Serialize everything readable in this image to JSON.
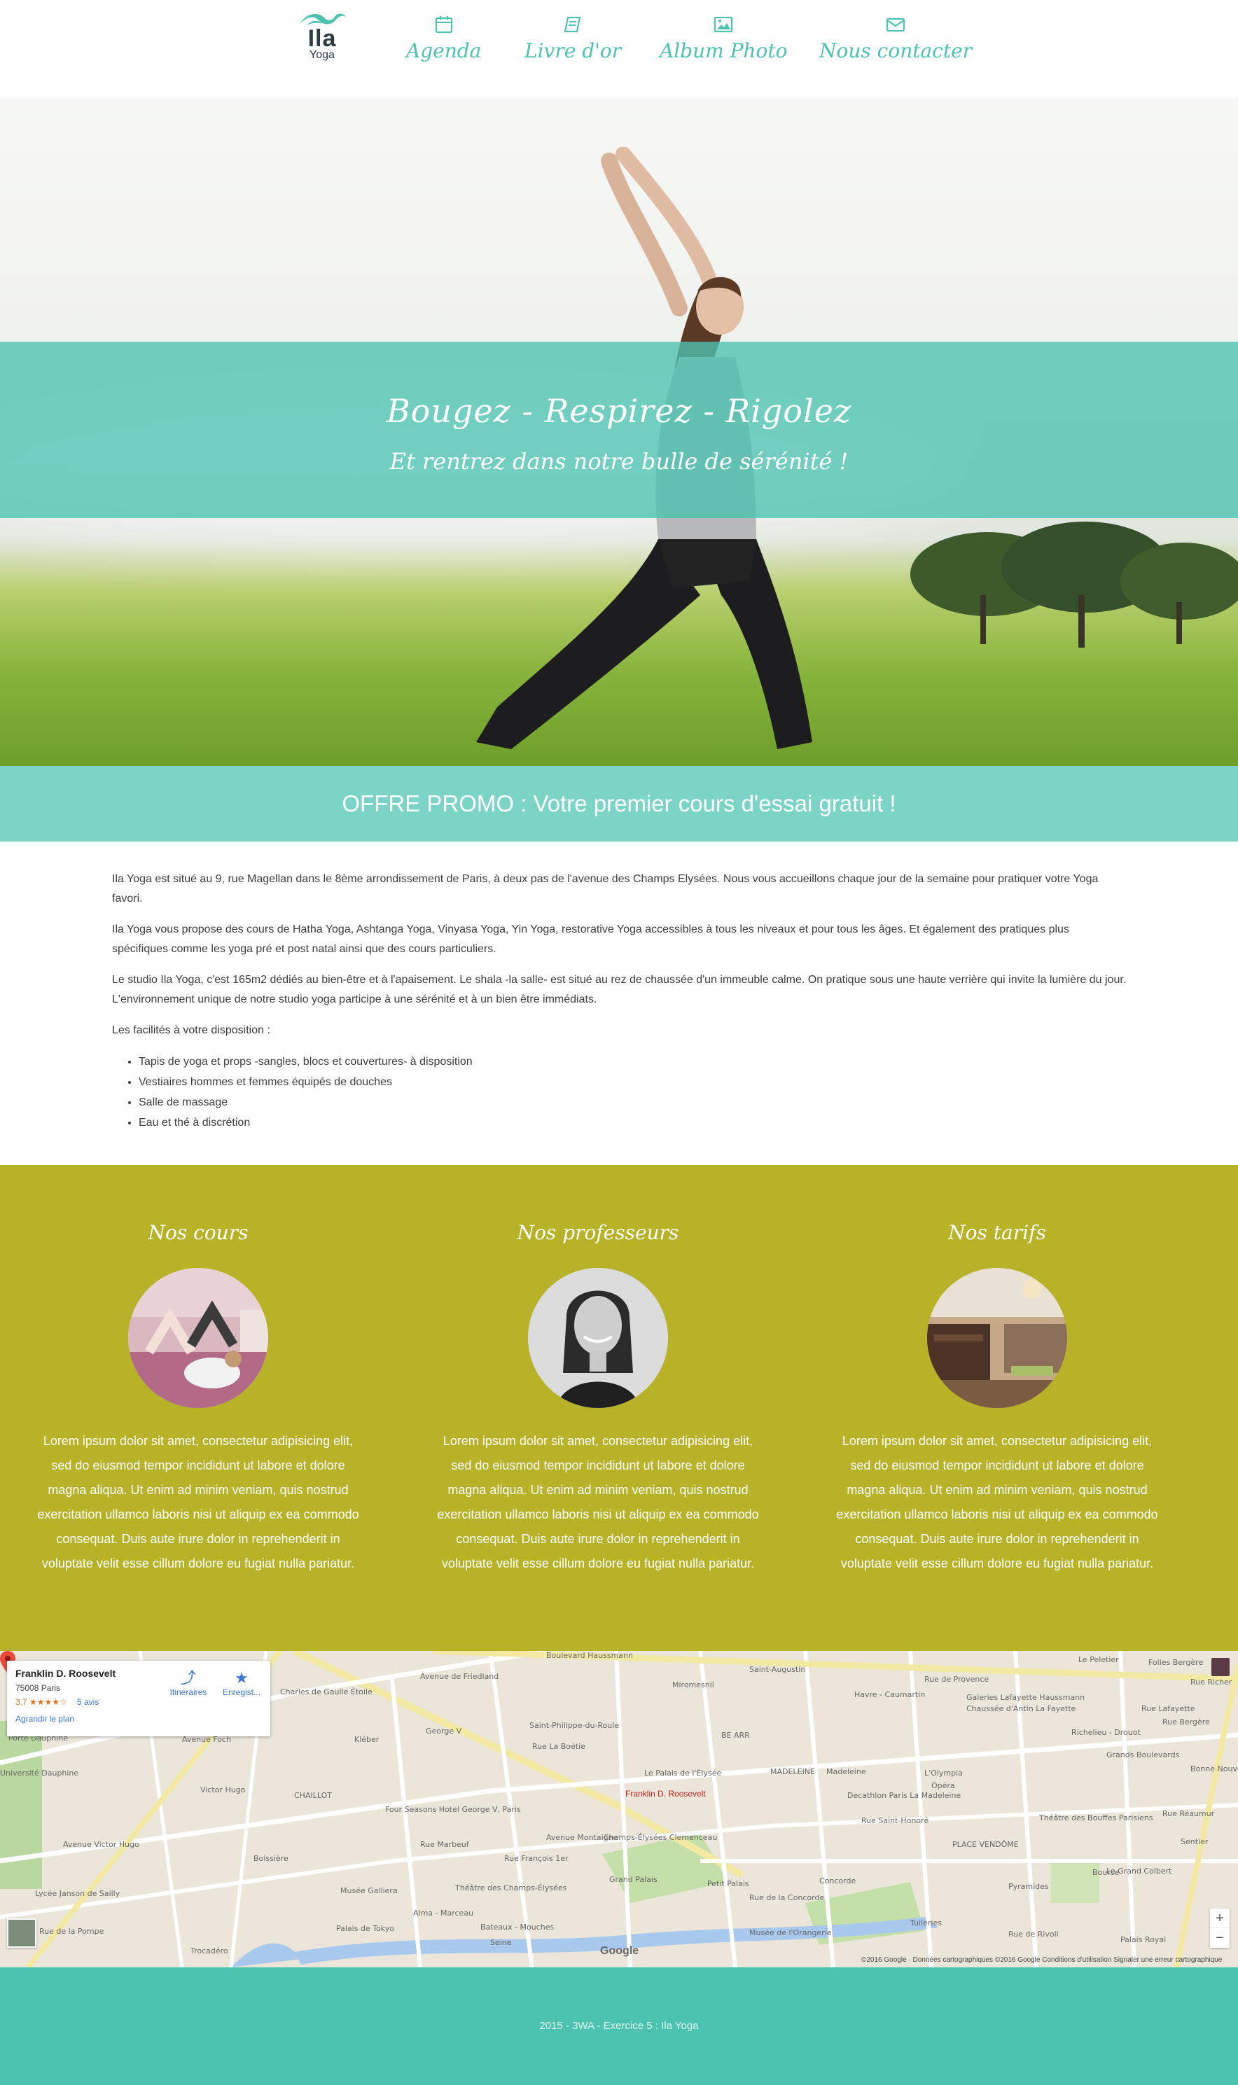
{
  "header": {
    "logo_name": "Ila",
    "logo_sub": "Yoga",
    "nav": [
      {
        "label": "Agenda",
        "icon": "calendar-icon"
      },
      {
        "label": "Livre d'or",
        "icon": "book-icon"
      },
      {
        "label": "Album Photo",
        "icon": "picture-icon"
      },
      {
        "label": "Nous contacter",
        "icon": "envelope-icon"
      }
    ]
  },
  "hero": {
    "title": "Bougez - Respirez - Rigolez",
    "subtitle": "Et rentrez dans notre bulle de sérénité !"
  },
  "promo": "OFFRE PROMO : Votre premier cours d'essai gratuit !",
  "intro": {
    "paragraphs": [
      "Ila Yoga est situé au 9, rue Magellan dans le 8ème arrondissement de Paris, à deux pas de l'avenue des Champs Elysées. Nous vous accueillons chaque jour de la semaine pour pratiquer votre Yoga favori.",
      "Ila Yoga vous propose des cours de Hatha Yoga, Ashtanga Yoga, Vinyasa Yoga, Yin Yoga, restorative Yoga accessibles à tous les niveaux et pour tous les âges. Et également des pratiques plus spécifiques comme les yoga pré et post natal ainsi que des cours particuliers.",
      "Le studio Ila Yoga, c'est 165m2 dédiés au bien-être et à l'apaisement. Le shala -la salle- est situé au rez de chaussée d'un immeuble calme. On pratique sous une haute verrière qui invite la lumière du jour. L'environnement unique de notre studio yoga participe à une sérénité et à un bien être immédiats.",
      "Les facilités à votre disposition :"
    ],
    "facilities": [
      "Tapis de yoga et props -sangles, blocs et couvertures- à disposition",
      "Vestiaires hommes et femmes équipés de douches",
      "Salle de massage",
      "Eau et thé à discrétion"
    ]
  },
  "features": [
    {
      "title": "Nos cours",
      "text": "Lorem ipsum dolor sit amet, consectetur adipisicing elit, sed do eiusmod tempor incididunt ut labore et dolore magna aliqua. Ut enim ad minim veniam, quis nostrud exercitation ullamco laboris nisi ut aliquip ex ea commodo consequat. Duis aute irure dolor in reprehenderit in voluptate velit esse cillum dolore eu fugiat nulla pariatur."
    },
    {
      "title": "Nos professeurs",
      "text": "Lorem ipsum dolor sit amet, consectetur adipisicing elit, sed do eiusmod tempor incididunt ut labore et dolore magna aliqua. Ut enim ad minim veniam, quis nostrud exercitation ullamco laboris nisi ut aliquip ex ea commodo consequat. Duis aute irure dolor in reprehenderit in voluptate velit esse cillum dolore eu fugiat nulla pariatur."
    },
    {
      "title": "Nos tarifs",
      "text": "Lorem ipsum dolor sit amet, consectetur adipisicing elit, sed do eiusmod tempor incididunt ut labore et dolore magna aliqua. Ut enim ad minim veniam, quis nostrud exercitation ullamco laboris nisi ut aliquip ex ea commodo consequat. Duis aute irure dolor in reprehenderit in voluptate velit esse cillum dolore eu fugiat nulla pariatur."
    }
  ],
  "map": {
    "place_name": "Franklin D. Roosevelt",
    "place_address": "75008 Paris",
    "rating": "3,7 ★★★★☆",
    "reviews": "5 avis",
    "enlarge": "Agrandir le plan",
    "directions": "Itinéraires",
    "save": "Enregist...",
    "zoom_in": "+",
    "zoom_out": "−",
    "google": "Google",
    "footer": "©2016 Google · Données cartographiques ©2016 Google   Conditions d'utilisation   Signaler une erreur cartographique",
    "pin_label": "Franklin D. Roosevelt",
    "street_labels": [
      "Avenue de Friedland",
      "Boulevard Haussmann",
      "Saint-Augustin",
      "Miromesnil",
      "Rue de Provence",
      "Galeries Lafayette Haussmann",
      "Havre - Caumartin",
      "Chaussée d'Antin La Fayette",
      "Richelieu - Drouot",
      "Grands Boulevards",
      "Bonne Nouvelle",
      "Rue Bergère",
      "Charles de Gaulle Étoile",
      "Avenue Foch",
      "Kléber",
      "George V",
      "Saint-Philippe-du-Roule",
      "Rue La Boétie",
      "BE ARR",
      "MADELEINE",
      "Madeleine",
      "L'Olympia",
      "Opéra",
      "Rue Saint-Honoré",
      "Pyramides",
      "Le Grand Colbert",
      "Rue de Rivoli",
      "Palais Royal",
      "Tuileries",
      "Concorde",
      "Champs-Élysées Clemenceau",
      "Grand Palais",
      "Petit Palais",
      "Rue de la Concorde",
      "Musée de l'Orangerie",
      "Seine",
      "Bateaux - Mouches",
      "Alma - Marceau",
      "Trocadéro",
      "Boissière",
      "CHAILLOT",
      "Victor Hugo",
      "Avenue Victor Hugo",
      "Rue de la Pompe",
      "Four Seasons Hotel George V, Paris",
      "Le Palais de l'Élysée",
      "Rue de Rivoli",
      "Palais de Tokyo",
      "Musée Galliera",
      "Théâtre des Champs-Élysées",
      "Porte Dauphine",
      "Avenue Foch",
      "Université Dauphine",
      "Lycée Janson de Sailly",
      "Decathlon Paris La Madeleine",
      "Théâtre des Bouffes Parisiens",
      "Sentier",
      "Rue Réaumur",
      "Le Peletier",
      "Folies Bergère",
      "Rue Richer",
      "Rue Lafayette",
      "Bourse",
      "PLACE VENDÔME",
      "Avenue Montaigne",
      "Rue Marbeuf",
      "Rue François 1er"
    ]
  },
  "footer": "2015 - 3WA - Exercice 5 : Ila Yoga",
  "colors": {
    "teal": "#4cc3b1",
    "teal_light": "#7bd4c6",
    "olive": "#b8b229",
    "dark": "#2d3a40"
  }
}
